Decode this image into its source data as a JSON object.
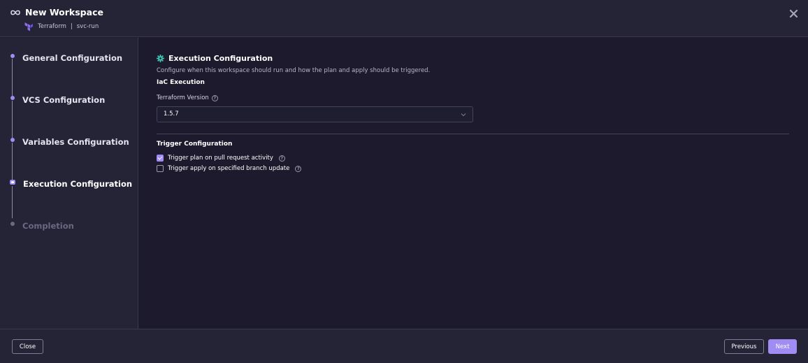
{
  "header": {
    "title": "New Workspace",
    "provider": "Terraform",
    "separator": "|",
    "workspace_id": "svc-run",
    "logo_icon": "infinity-icon",
    "provider_icon": "terraform-logo-icon",
    "close_icon": "close-icon"
  },
  "steps": [
    {
      "label": "General Configuration",
      "state": "done"
    },
    {
      "label": "VCS Configuration",
      "state": "done"
    },
    {
      "label": "Variables Configuration",
      "state": "done"
    },
    {
      "label": "Execution Configuration",
      "state": "current"
    },
    {
      "label": "Completion",
      "state": "pending"
    }
  ],
  "main": {
    "section_title": "Execution Configuration",
    "section_icon": "gear-icon",
    "section_description": "Configure when this workspace should run and how the plan and apply should be triggered.",
    "iac_title": "IaC Execution",
    "terraform_version_label": "Terraform Version",
    "terraform_version_value": "1.5.7",
    "trigger_title": "Trigger Configuration",
    "triggers": [
      {
        "label": "Trigger plan on pull request activity",
        "checked": true
      },
      {
        "label": "Trigger apply on specified branch update",
        "checked": false
      }
    ],
    "help_glyph": "?"
  },
  "footer": {
    "close_label": "Close",
    "previous_label": "Previous",
    "next_label": "Next"
  },
  "colors": {
    "accent": "#a08cf2",
    "background": "#1c1a2c",
    "panel": "#252336",
    "gear": "#3fc6b5"
  }
}
